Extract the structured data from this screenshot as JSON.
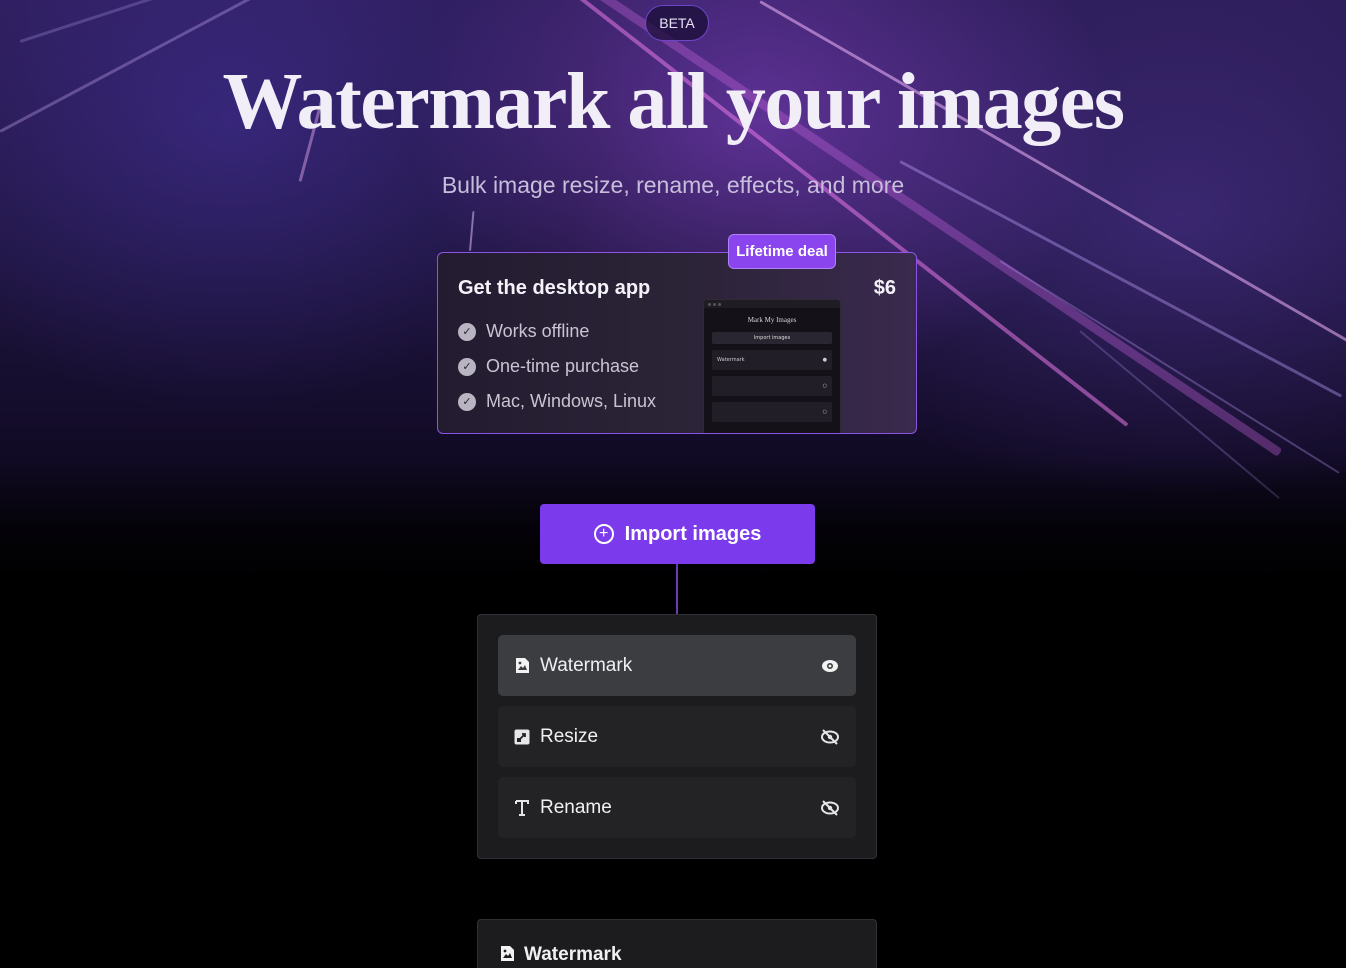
{
  "hero": {
    "badge": "BETA",
    "title": "Watermark all your images",
    "subtitle": "Bulk image resize, rename, effects, and more"
  },
  "desktop_offer": {
    "title": "Get the desktop app",
    "price": "$6",
    "badge": "Lifetime deal",
    "features": [
      "Works offline",
      "One-time purchase",
      "Mac, Windows, Linux"
    ],
    "preview": {
      "app_title": "Mark My Images",
      "import_label": "Import images",
      "first_row_label": "Watermark"
    }
  },
  "import_button": {
    "label": "Import images",
    "icon": "plus-circle-icon"
  },
  "steps": [
    {
      "label": "Watermark",
      "icon": "image-file-icon",
      "visibility_icon": "eye-icon",
      "visible": true,
      "active": true
    },
    {
      "label": "Resize",
      "icon": "resize-icon",
      "visibility_icon": "eye-off-icon",
      "visible": false,
      "active": false
    },
    {
      "label": "Rename",
      "icon": "text-icon",
      "visibility_icon": "eye-off-icon",
      "visible": false,
      "active": false
    }
  ],
  "bottom_card": {
    "title": "Watermark",
    "icon": "image-file-icon"
  },
  "colors": {
    "accent": "#7c3aed",
    "badge": "#8b45ee",
    "panel": "#1c1c1f",
    "active_step": "#3b3d40"
  }
}
